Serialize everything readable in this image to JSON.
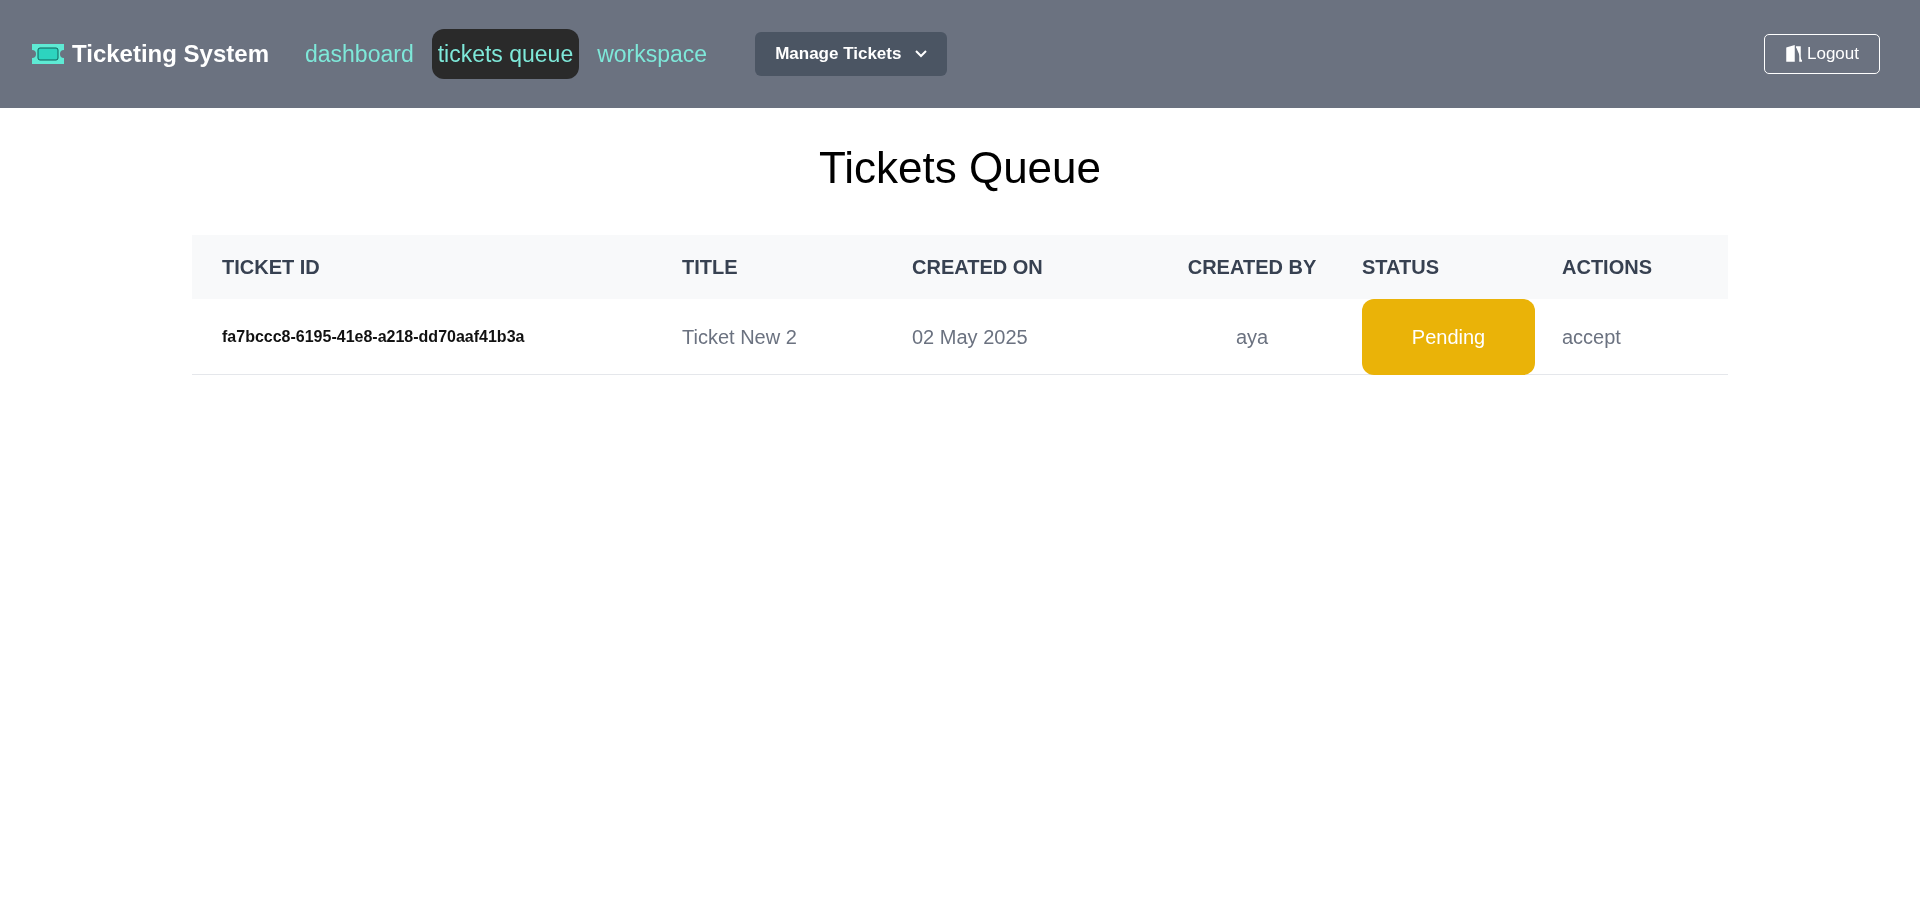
{
  "navbar": {
    "brand": "Ticketing System",
    "links": [
      {
        "label": "dashboard",
        "selected": false
      },
      {
        "label": "tickets queue",
        "selected": true
      },
      {
        "label": "workspace",
        "selected": false
      }
    ],
    "menu_button": "Manage Tickets",
    "logout": "Logout"
  },
  "page_title": "Tickets Queue",
  "table": {
    "columns": [
      "TICKET ID",
      "TITLE",
      "CREATED ON",
      "CREATED BY",
      "STATUS",
      "ACTIONS"
    ],
    "rows": [
      {
        "ticket_id": "fa7bccc8-6195-41e8-a218-dd70aaf41b3a",
        "title": "Ticket New 2",
        "created_on": "02 May 2025",
        "created_by": "aya",
        "status": {
          "label": "Pending",
          "kind": "pending"
        },
        "action": "accept"
      }
    ]
  }
}
